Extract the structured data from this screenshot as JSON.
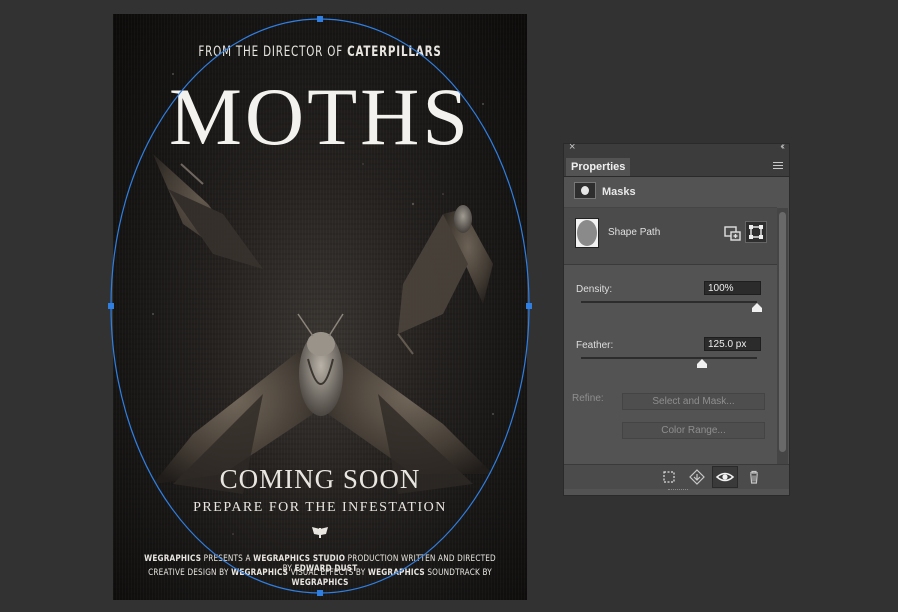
{
  "poster": {
    "tagline_prefix": "FROM THE DIRECTOR OF ",
    "tagline_bold": "CATERPILLARS",
    "title": "MOTHS",
    "coming_soon": "COMING SOON",
    "subtitle": "PREPARE FOR THE INFESTATION",
    "credits_line1": [
      {
        "t": "WEGRAPHICS",
        "b": true
      },
      {
        "t": " PRESENTS A ",
        "b": false
      },
      {
        "t": "WEGRAPHICS STUDIO",
        "b": true
      },
      {
        "t": " PRODUCTION WRITTEN AND DIRECTED BY ",
        "b": false
      },
      {
        "t": "EDWARD DUST",
        "b": true
      }
    ],
    "credits_line2": [
      {
        "t": "CREATIVE DESIGN BY ",
        "b": false
      },
      {
        "t": "WEGRAPHICS",
        "b": true
      },
      {
        "t": " VISUAL EFFECTS BY ",
        "b": false
      },
      {
        "t": "WEGRAPHICS",
        "b": true
      },
      {
        "t": " SOUNDTRACK BY ",
        "b": false
      },
      {
        "t": "WEGRAPHICS",
        "b": true
      }
    ]
  },
  "selection": {
    "shape": "ellipse",
    "stroke_color": "#2f7fe3"
  },
  "panel": {
    "close_glyph": "×",
    "collapse_glyph": "‹‹",
    "tab_label": "Properties",
    "section_label": "Masks",
    "shape_label": "Shape Path",
    "density_label": "Density:",
    "density_value": "100%",
    "density_fraction": 1.0,
    "feather_label": "Feather:",
    "feather_value": "125.0 px",
    "feather_fraction": 0.69,
    "refine_label": "Refine:",
    "select_and_mask_label": "Select and Mask...",
    "color_range_label": "Color Range...",
    "icons": {
      "add_vector_mask": "add-vector-mask-icon",
      "vector_mask": "vector-mask-icon",
      "load_selection": "selection-marquee-icon",
      "apply_mask": "apply-mask-icon",
      "toggle_visibility": "eye-icon",
      "delete": "trash-icon"
    }
  }
}
